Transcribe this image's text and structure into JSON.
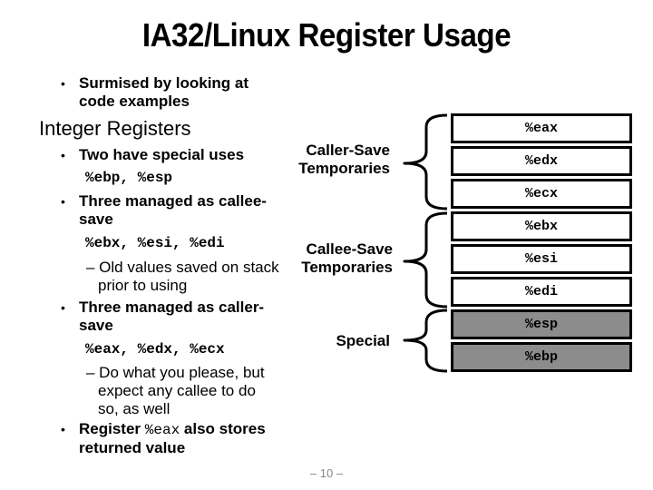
{
  "title": "IA32/Linux Register Usage",
  "intro_bullet": {
    "line1": "Surmised by looking at",
    "line2": "code examples"
  },
  "section_heading": "Integer Registers",
  "bullets": [
    {
      "line1": "Two have special uses",
      "code": "%ebp, %esp"
    },
    {
      "line1": "Three managed as callee-",
      "line2": "save",
      "code": "%ebx, %esi, %edi",
      "sub": {
        "line1": "– Old values saved on stack",
        "line2": "prior to using"
      }
    },
    {
      "line1": "Three managed as caller-",
      "line2": "save",
      "code": "%eax, %edx, %ecx",
      "sub": {
        "line1": "– Do what you please, but",
        "line2": "expect any callee to do",
        "line3": "so, as well"
      }
    },
    {
      "pre": "Register",
      "code": "%eax",
      "post": "also stores",
      "line2": "returned value"
    }
  ],
  "bullet_glyph": "•",
  "groups": [
    {
      "line1": "Caller-Save",
      "line2": "Temporaries"
    },
    {
      "line1": "Callee-Save",
      "line2": "Temporaries"
    },
    {
      "line1": "Special"
    }
  ],
  "registers": [
    {
      "name": "%eax",
      "group": "caller-save"
    },
    {
      "name": "%edx",
      "group": "caller-save"
    },
    {
      "name": "%ecx",
      "group": "caller-save"
    },
    {
      "name": "%ebx",
      "group": "callee-save"
    },
    {
      "name": "%esi",
      "group": "callee-save"
    },
    {
      "name": "%edi",
      "group": "callee-save"
    },
    {
      "name": "%esp",
      "group": "special"
    },
    {
      "name": "%ebp",
      "group": "special"
    }
  ],
  "colors": {
    "special_fill": "#8c8c8c",
    "normal_fill": "#ffffff"
  },
  "page_number": "– 10 –"
}
